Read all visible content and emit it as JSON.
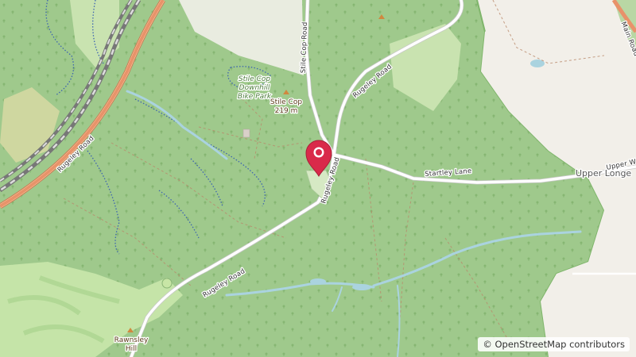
{
  "map": {
    "roads": {
      "rugeley_road_upper": "Rugeley Road",
      "rugeley_road_mid": "Rugeley Road",
      "rugeley_road_lower": "Rugeley Road",
      "rugeley_road_west": "Rugeley Road",
      "stile_cop_road": "Stile Cop Road",
      "startley_lane": "Startley Lane",
      "main_road": "Main Road",
      "upper_road_fragment": "Upper W"
    },
    "places": {
      "bike_park_line1": "Stile Cop",
      "bike_park_line2": "Downhill",
      "bike_park_line3": "Bike Park",
      "peak_name": "Stile Cop",
      "peak_elevation": "219 m",
      "hill_line1": "Rawnsley",
      "hill_line2": "Hill",
      "village_fragment": "Upper Longe"
    },
    "attribution": {
      "symbol": "©",
      "text": "OpenStreetMap contributors"
    },
    "colors": {
      "forest": "#9fc98c",
      "background": "#f2efe9",
      "road_orange": "#e8926a",
      "marker": "#d92a4a"
    }
  }
}
